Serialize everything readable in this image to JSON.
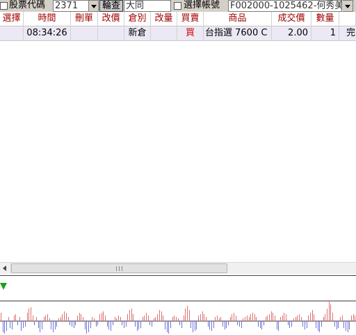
{
  "toolbar": {
    "stock_label": "股票代碼",
    "stock_code": "2371",
    "query_label": "輪查",
    "stock_name": "大同",
    "select_account_label": "選擇帳號",
    "account_value": "F002000-1025462-何秀美"
  },
  "grid": {
    "columns": [
      "選擇",
      "時間",
      "刪單",
      "改價",
      "倉別",
      "改量",
      "買賣",
      "商品",
      "成交價",
      "數量",
      "完"
    ],
    "rows": [
      {
        "select": "",
        "time": "08:34:26",
        "delete": "",
        "modify_price": "",
        "position": "新倉",
        "modify_qty": "",
        "side": "買",
        "product": "台指選  7600 C",
        "price": "2.00",
        "qty": "1",
        "status": "完"
      }
    ]
  },
  "colors": {
    "header_text": "#a00000",
    "buy_text": "#d00000",
    "row_bg": "#ece9f5",
    "bar_up": "#e07070",
    "bar_down": "#7070d8",
    "marker": "#1aa01a"
  },
  "chart_data": {
    "type": "bar",
    "series": [
      {
        "values": [
          0.6,
          -0.8,
          -0.9,
          -0.7,
          0.3,
          -0.5,
          -0.6,
          0.4,
          0.5,
          -0.3,
          0.3,
          -0.7,
          -0.5,
          -0.4,
          0.6,
          0.9,
          1.0,
          0.4,
          -0.3,
          0.3,
          -0.5,
          -0.8,
          -0.6,
          0.3,
          0.4,
          0.5,
          0.2,
          -0.6,
          -0.8,
          -0.6,
          -0.4,
          0.2,
          0.3,
          0.5,
          0.7,
          0.6,
          0.3,
          -0.3,
          -0.4,
          -0.5,
          -0.3,
          0.4,
          0.6,
          0.5,
          0.3,
          -0.6,
          -0.9,
          -0.8,
          -0.5,
          0.3,
          0.2,
          -0.4,
          -0.3,
          0.5,
          0.6,
          0.7,
          0.4,
          -0.4,
          -0.6,
          -0.7,
          -0.3,
          0.3,
          0.2,
          0.4,
          0.3,
          -0.3,
          -0.5,
          -0.4,
          0.5,
          0.8,
          0.9,
          0.5,
          -0.4,
          -0.7,
          -0.6,
          -0.5,
          0.3,
          0.4,
          0.6,
          0.4,
          -0.3,
          -0.4,
          0.2,
          0.3,
          0.5,
          0.8,
          0.7,
          0.4,
          -0.6,
          -0.8,
          -0.9,
          -0.5,
          0.3,
          0.4,
          0.3,
          0.2,
          -0.3,
          -0.5,
          0.4,
          0.9,
          1.1,
          0.8,
          -0.5,
          -0.8,
          -0.7,
          -0.6,
          0.4,
          0.5,
          0.7,
          0.5,
          0.3,
          -0.4,
          -0.6,
          -0.7,
          -0.5,
          0.3,
          0.4,
          0.2,
          0.3,
          -0.4,
          -0.6,
          -0.5,
          -0.3,
          0.3,
          0.5,
          0.6,
          0.4,
          -0.3,
          -0.4,
          -0.5,
          0.2,
          0.3,
          0.4,
          0.3,
          0.5,
          0.6,
          0.5,
          0.3,
          -0.4,
          -0.5,
          -0.6,
          -0.3,
          0.3,
          0.4,
          0.5,
          0.7,
          0.6,
          0.4,
          -0.6,
          -0.7,
          0.3,
          0.4,
          0.6,
          0.5,
          -0.3,
          -0.5,
          -0.4,
          0.2,
          0.3,
          0.4,
          0.5,
          0.3,
          -0.4,
          -0.6,
          -0.5,
          0.4,
          0.6,
          0.8,
          0.5,
          -0.5,
          -0.7,
          -0.8,
          -0.4,
          0.3,
          0.5,
          0.9,
          1.5,
          1.2,
          0.6,
          -0.4,
          -0.6,
          -0.5,
          0.3,
          0.4,
          -0.5,
          -0.7,
          -0.8,
          -0.6,
          0.4,
          0.5,
          0.4
        ]
      }
    ]
  }
}
